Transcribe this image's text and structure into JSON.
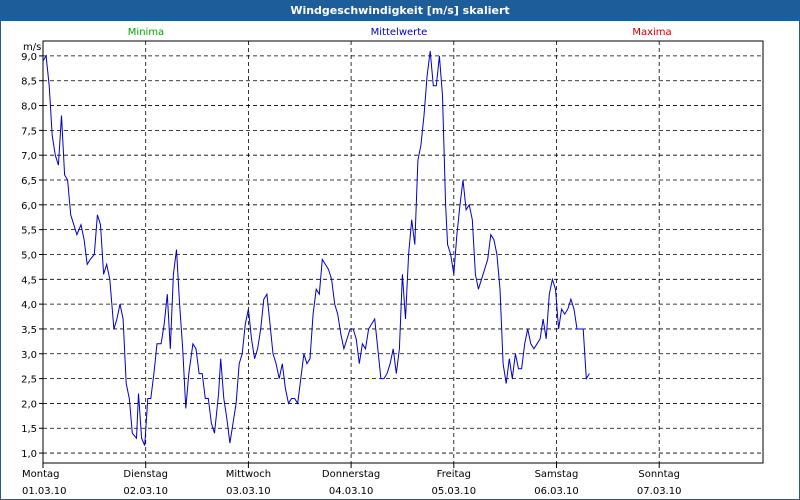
{
  "window": {
    "title": "Windgeschwindigkeit [m/s] skaliert"
  },
  "legend": [
    {
      "label": "Minima",
      "color": "#00aa00"
    },
    {
      "label": "Mittelwerte",
      "color": "#0000cc"
    },
    {
      "label": "Maxima",
      "color": "#cc0000"
    }
  ],
  "chart_data": {
    "type": "line",
    "title": "Windgeschwindigkeit [m/s] skaliert",
    "ylabel": "m/s",
    "ylim": [
      0.8,
      9.3
    ],
    "yticks": [
      "1,0",
      "1,5",
      "2,0",
      "2,5",
      "3,0",
      "3,5",
      "4,0",
      "4,5",
      "5,0",
      "5,5",
      "6,0",
      "6,5",
      "7,0",
      "7,5",
      "8,0",
      "8,5",
      "9,0"
    ],
    "x_days": [
      {
        "day": "Montag",
        "date": "01.03.10"
      },
      {
        "day": "Dienstag",
        "date": "02.03.10"
      },
      {
        "day": "Mittwoch",
        "date": "03.03.10"
      },
      {
        "day": "Donnerstag",
        "date": "04.03.10"
      },
      {
        "day": "Freitag",
        "date": "05.03.10"
      },
      {
        "day": "Samstag",
        "date": "06.03.10"
      },
      {
        "day": "Sonntag",
        "date": "07.03.10"
      }
    ],
    "x_unit": "days since 01.03.10 00:00",
    "grid": true,
    "series": [
      {
        "name": "Mittelwerte",
        "color": "#0000cc",
        "points": [
          [
            0.0,
            8.9
          ],
          [
            0.03,
            9.0
          ],
          [
            0.06,
            8.4
          ],
          [
            0.09,
            7.4
          ],
          [
            0.12,
            7.0
          ],
          [
            0.15,
            6.8
          ],
          [
            0.18,
            7.8
          ],
          [
            0.21,
            6.6
          ],
          [
            0.24,
            6.5
          ],
          [
            0.27,
            5.8
          ],
          [
            0.3,
            5.6
          ],
          [
            0.33,
            5.4
          ],
          [
            0.37,
            5.6
          ],
          [
            0.4,
            5.3
          ],
          [
            0.43,
            4.8
          ],
          [
            0.46,
            4.9
          ],
          [
            0.5,
            5.0
          ],
          [
            0.53,
            5.8
          ],
          [
            0.56,
            5.6
          ],
          [
            0.59,
            4.6
          ],
          [
            0.62,
            4.8
          ],
          [
            0.65,
            4.5
          ],
          [
            0.69,
            3.5
          ],
          [
            0.72,
            3.7
          ],
          [
            0.75,
            4.0
          ],
          [
            0.78,
            3.7
          ],
          [
            0.81,
            2.4
          ],
          [
            0.84,
            2.1
          ],
          [
            0.87,
            1.4
          ],
          [
            0.91,
            1.3
          ],
          [
            0.93,
            2.2
          ],
          [
            0.96,
            1.3
          ],
          [
            0.99,
            1.15
          ],
          [
            1.02,
            2.1
          ],
          [
            1.05,
            2.1
          ],
          [
            1.08,
            2.6
          ],
          [
            1.11,
            3.2
          ],
          [
            1.15,
            3.2
          ],
          [
            1.18,
            3.6
          ],
          [
            1.21,
            4.2
          ],
          [
            1.24,
            3.1
          ],
          [
            1.27,
            4.6
          ],
          [
            1.3,
            5.1
          ],
          [
            1.33,
            4.0
          ],
          [
            1.36,
            3.1
          ],
          [
            1.39,
            1.9
          ],
          [
            1.42,
            2.6
          ],
          [
            1.46,
            3.2
          ],
          [
            1.49,
            3.1
          ],
          [
            1.52,
            2.6
          ],
          [
            1.55,
            2.6
          ],
          [
            1.58,
            2.1
          ],
          [
            1.61,
            2.1
          ],
          [
            1.64,
            1.6
          ],
          [
            1.67,
            1.4
          ],
          [
            1.71,
            2.2
          ],
          [
            1.73,
            2.9
          ],
          [
            1.76,
            2.1
          ],
          [
            1.79,
            1.7
          ],
          [
            1.82,
            1.2
          ],
          [
            1.85,
            1.6
          ],
          [
            1.88,
            2.0
          ],
          [
            1.91,
            2.8
          ],
          [
            1.94,
            3.0
          ],
          [
            1.97,
            3.6
          ],
          [
            2.0,
            3.9
          ],
          [
            2.03,
            3.3
          ],
          [
            2.06,
            2.9
          ],
          [
            2.09,
            3.1
          ],
          [
            2.12,
            3.5
          ],
          [
            2.15,
            4.1
          ],
          [
            2.18,
            4.2
          ],
          [
            2.21,
            3.6
          ],
          [
            2.24,
            3.0
          ],
          [
            2.27,
            2.8
          ],
          [
            2.3,
            2.5
          ],
          [
            2.33,
            2.8
          ],
          [
            2.36,
            2.3
          ],
          [
            2.39,
            2.0
          ],
          [
            2.42,
            2.1
          ],
          [
            2.45,
            2.1
          ],
          [
            2.48,
            2.0
          ],
          [
            2.51,
            2.5
          ],
          [
            2.54,
            3.0
          ],
          [
            2.57,
            2.8
          ],
          [
            2.6,
            2.9
          ],
          [
            2.63,
            3.8
          ],
          [
            2.66,
            4.3
          ],
          [
            2.69,
            4.2
          ],
          [
            2.72,
            4.9
          ],
          [
            2.75,
            4.8
          ],
          [
            2.78,
            4.7
          ],
          [
            2.81,
            4.5
          ],
          [
            2.84,
            4.0
          ],
          [
            2.87,
            3.8
          ],
          [
            2.9,
            3.4
          ],
          [
            2.93,
            3.1
          ],
          [
            2.96,
            3.3
          ],
          [
            2.99,
            3.5
          ],
          [
            3.02,
            3.5
          ],
          [
            3.05,
            3.3
          ],
          [
            3.08,
            2.8
          ],
          [
            3.11,
            3.2
          ],
          [
            3.14,
            3.1
          ],
          [
            3.17,
            3.5
          ],
          [
            3.2,
            3.6
          ],
          [
            3.23,
            3.7
          ],
          [
            3.26,
            3.1
          ],
          [
            3.29,
            2.5
          ],
          [
            3.32,
            2.5
          ],
          [
            3.35,
            2.6
          ],
          [
            3.38,
            2.8
          ],
          [
            3.41,
            3.1
          ],
          [
            3.44,
            2.6
          ],
          [
            3.47,
            3.1
          ],
          [
            3.5,
            4.6
          ],
          [
            3.53,
            3.7
          ],
          [
            3.56,
            5.0
          ],
          [
            3.59,
            5.7
          ],
          [
            3.62,
            5.2
          ],
          [
            3.65,
            6.9
          ],
          [
            3.68,
            7.2
          ],
          [
            3.71,
            7.8
          ],
          [
            3.74,
            8.6
          ],
          [
            3.77,
            9.1
          ],
          [
            3.8,
            8.4
          ],
          [
            3.83,
            8.4
          ],
          [
            3.86,
            9.0
          ],
          [
            3.89,
            8.2
          ],
          [
            3.92,
            6.0
          ],
          [
            3.94,
            5.2
          ],
          [
            3.97,
            5.0
          ],
          [
            4.0,
            4.6
          ],
          [
            4.03,
            5.4
          ],
          [
            4.06,
            6.0
          ],
          [
            4.09,
            6.5
          ],
          [
            4.12,
            5.9
          ],
          [
            4.15,
            6.0
          ],
          [
            4.18,
            5.7
          ],
          [
            4.21,
            4.6
          ],
          [
            4.24,
            4.3
          ],
          [
            4.27,
            4.5
          ],
          [
            4.3,
            4.7
          ],
          [
            4.33,
            4.9
          ],
          [
            4.36,
            5.4
          ],
          [
            4.39,
            5.3
          ],
          [
            4.42,
            5.0
          ],
          [
            4.45,
            4.3
          ],
          [
            4.48,
            2.8
          ],
          [
            4.51,
            2.4
          ],
          [
            4.54,
            2.9
          ],
          [
            4.57,
            2.5
          ],
          [
            4.6,
            3.0
          ],
          [
            4.63,
            2.7
          ],
          [
            4.66,
            2.7
          ],
          [
            4.69,
            3.2
          ],
          [
            4.72,
            3.5
          ],
          [
            4.75,
            3.2
          ],
          [
            4.78,
            3.1
          ],
          [
            4.81,
            3.2
          ],
          [
            4.84,
            3.3
          ],
          [
            4.87,
            3.7
          ],
          [
            4.9,
            3.3
          ],
          [
            4.93,
            4.2
          ],
          [
            4.96,
            4.5
          ],
          [
            4.99,
            4.3
          ],
          [
            5.02,
            3.5
          ],
          [
            5.05,
            3.9
          ],
          [
            5.08,
            3.8
          ],
          [
            5.11,
            3.9
          ],
          [
            5.14,
            4.1
          ],
          [
            5.17,
            3.9
          ],
          [
            5.2,
            3.5
          ],
          [
            5.23,
            3.5
          ],
          [
            5.26,
            3.5
          ],
          [
            5.29,
            2.5
          ],
          [
            5.32,
            2.6
          ]
        ]
      }
    ]
  }
}
